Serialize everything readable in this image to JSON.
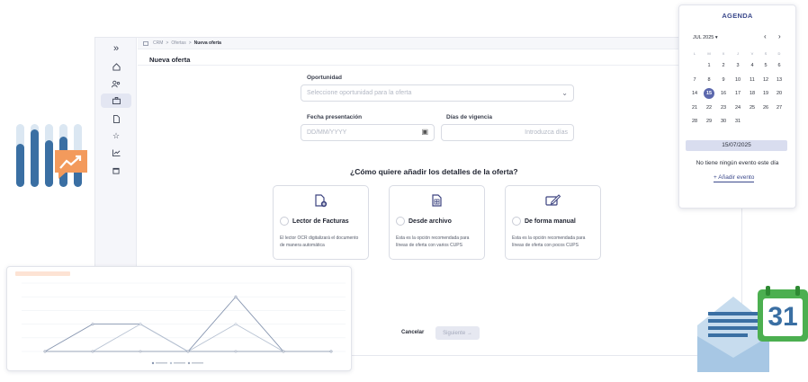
{
  "breadcrumb": {
    "root": "CRM",
    "section": "Ofertas",
    "current": "Nueva oferta"
  },
  "page": {
    "title": "Nueva oferta"
  },
  "form": {
    "opportunity_label": "Oportunidad",
    "opportunity_placeholder": "Seleccione oportunidad para la oferta",
    "date_label": "Fecha presentación",
    "date_placeholder": "DD/MM/YYYY",
    "validity_label": "Días de vigencia",
    "validity_placeholder": "Introduzca días"
  },
  "question": "¿Cómo quiere añadir los detalles de la oferta?",
  "options": [
    {
      "title": "Lector de Facturas",
      "desc": "El lector OCR digitalizará el documento de manera automática",
      "icon": "file-plus-icon"
    },
    {
      "title": "Desde archivo",
      "desc": "Esta es la opción recomendada para líneas de oferta con varios CUPS",
      "icon": "spreadsheet-file-icon"
    },
    {
      "title": "De forma manual",
      "desc": "Esta es la opción recomendada para líneas de oferta con pocos CUPS",
      "icon": "edit-pen-icon"
    }
  ],
  "actions": {
    "cancel": "Cancelar",
    "next": "Siguiente",
    "next_arrow": "→"
  },
  "rail_icons": [
    "chevrons-right-icon",
    "home-icon",
    "users-icon",
    "briefcase-icon",
    "document-icon",
    "star-icon",
    "chart-icon",
    "calendar-icon"
  ],
  "agenda": {
    "title": "AGENDA",
    "month": "JUL 2025 ▾",
    "prev": "‹",
    "next": "›",
    "weekdays": [
      "L",
      "M",
      "X",
      "J",
      "V",
      "S",
      "D"
    ],
    "weeks": [
      [
        "",
        "1",
        "2",
        "3",
        "4",
        "5",
        "6"
      ],
      [
        "7",
        "8",
        "9",
        "10",
        "11",
        "12",
        "13"
      ],
      [
        "14",
        "15",
        "16",
        "17",
        "18",
        "19",
        "20"
      ],
      [
        "21",
        "22",
        "23",
        "24",
        "25",
        "26",
        "27"
      ],
      [
        "28",
        "29",
        "30",
        "31",
        "",
        "",
        ""
      ]
    ],
    "selected_day": "15",
    "selected_date": "15/07/2025",
    "no_events": "No tiene ningún evento este día",
    "add_event": "+ Añadir evento"
  },
  "calendar_deco_number": "31",
  "colors": {
    "accent": "#5c68ad",
    "brand_blue": "#3d4480",
    "deco_blue": "#3a6fa3",
    "deco_orange": "#f39a5c",
    "deco_green": "#4caf50"
  },
  "chart_data": {
    "type": "line",
    "title": "",
    "categories": [
      "",
      "",
      "",
      "",
      "",
      "",
      ""
    ],
    "series": [
      {
        "name": "",
        "values": [
          0,
          1,
          1,
          0,
          2,
          0,
          0
        ],
        "color": "#8796b0"
      },
      {
        "name": "",
        "values": [
          0,
          0,
          1,
          0,
          1,
          0,
          0
        ],
        "color": "#b8c3d3"
      },
      {
        "name": "",
        "values": [
          0,
          0,
          0,
          0,
          0,
          0,
          0
        ],
        "color": "#9aa5b8"
      }
    ],
    "ylim": [
      0,
      2.5
    ],
    "grid": true,
    "legend": "bottom"
  }
}
